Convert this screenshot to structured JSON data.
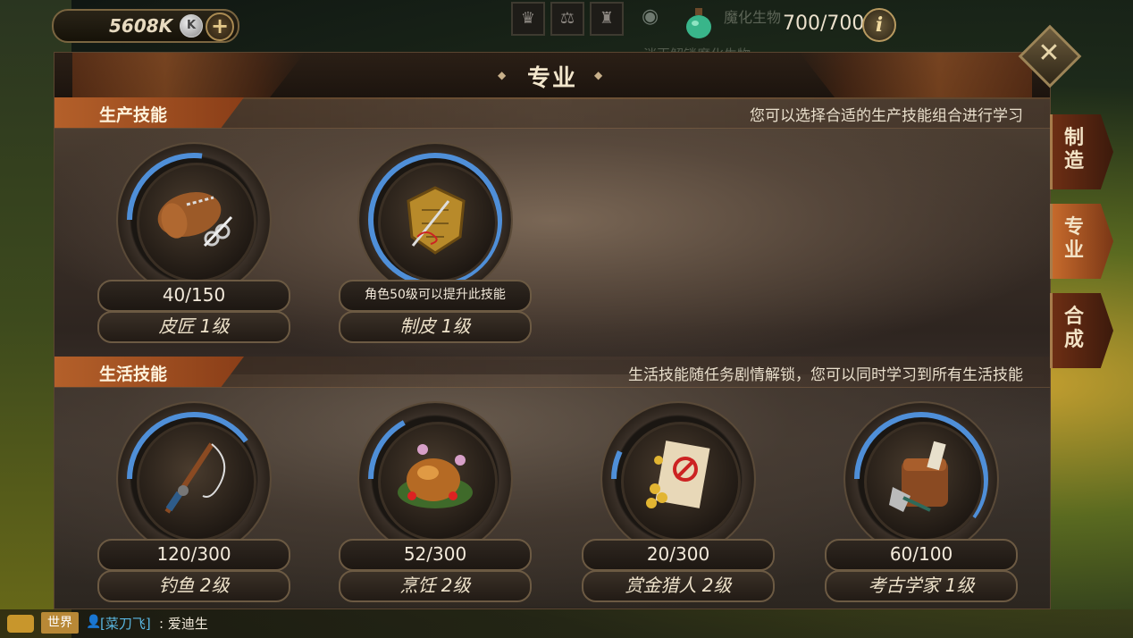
{
  "topbar": {
    "currency_value": "5608K",
    "coin_symbol": "K",
    "plus_symbol": "+",
    "stamina": "700/700",
    "info_symbol": "i",
    "faded_label": "魔化生物",
    "faded_label_2": "消灭解锁魔化生物"
  },
  "panel": {
    "title": "专业",
    "close_symbol": "✕"
  },
  "production": {
    "title": "生产技能",
    "hint": "您可以选择合适的生产技能组合进行学习",
    "skills": [
      {
        "value": "40/150",
        "name": "皮匠 1级",
        "icon": "leather-roll-scissors-icon",
        "progress": 0.27
      },
      {
        "value": "角色50级可以提升此技能",
        "name": "制皮 1级",
        "icon": "leather-armor-needle-icon",
        "progress": 1.0
      }
    ]
  },
  "life": {
    "title": "生活技能",
    "hint": "生活技能随任务剧情解锁，您可以同时学习到所有生活技能",
    "skills": [
      {
        "value": "120/300",
        "name": "钓鱼 2级",
        "icon": "fishing-rod-icon",
        "progress": 0.4
      },
      {
        "value": "52/300",
        "name": "烹饪 2级",
        "icon": "roast-chicken-icon",
        "progress": 0.17
      },
      {
        "value": "20/300",
        "name": "赏金猎人 2级",
        "icon": "bounty-scroll-icon",
        "progress": 0.07
      },
      {
        "value": "60/100",
        "name": "考古学家 1级",
        "icon": "archaeology-bag-icon",
        "progress": 0.6
      }
    ]
  },
  "side_tabs": [
    {
      "label": "制造",
      "active": false
    },
    {
      "label": "专业",
      "active": true
    },
    {
      "label": "合成",
      "active": false
    }
  ],
  "chat": {
    "channel": "世界",
    "user": "[菜刀飞]",
    "message": ": 爱迪生"
  },
  "colors": {
    "progress_ring": "#4f8fd8",
    "accent_orange": "#b4602a"
  }
}
